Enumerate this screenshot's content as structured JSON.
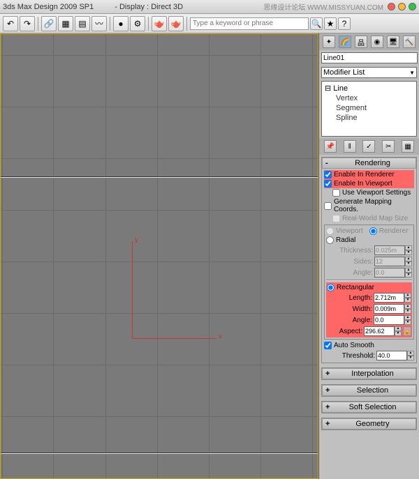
{
  "titlebar": {
    "app": "3ds Max Design 2009 SP1",
    "display": "- Display : Direct 3D",
    "watermark": "思缘设计论坛 WWW.MISSYUAN.COM"
  },
  "toolbar": {
    "search_placeholder": "Type a keyword or phrase"
  },
  "viewport": {
    "axis_x": "x",
    "axis_y": "y"
  },
  "panel": {
    "object_name": "Line01",
    "modifier_list": "Modifier List",
    "stack": {
      "root": "Line",
      "subs": [
        "Vertex",
        "Segment",
        "Spline"
      ]
    }
  },
  "render": {
    "title": "Rendering",
    "enable_render": "Enable In Renderer",
    "enable_viewport": "Enable In Viewport",
    "use_vp_settings": "Use Viewport Settings",
    "gen_mapping": "Generate Mapping Coords.",
    "real_world": "Real-World Map Size",
    "vp": "Viewport",
    "rend": "Renderer",
    "radial": "Radial",
    "thickness": "Thickness:",
    "thickness_v": "0.025m",
    "sides": "Sides:",
    "sides_v": "12",
    "angle": "Angle:",
    "angle_v": "0.0",
    "rect": "Rectangular",
    "length": "Length:",
    "length_v": "2.712m",
    "width": "Width:",
    "width_v": "0.009m",
    "angle2": "Angle:",
    "angle2_v": "0.0",
    "aspect": "Aspect:",
    "aspect_v": "296.62",
    "auto_smooth": "Auto Smooth",
    "threshold": "Threshold:",
    "threshold_v": "40.0"
  },
  "rollouts": {
    "interp": "Interpolation",
    "selection": "Selection",
    "soft_sel": "Soft Selection",
    "geometry": "Geometry"
  }
}
